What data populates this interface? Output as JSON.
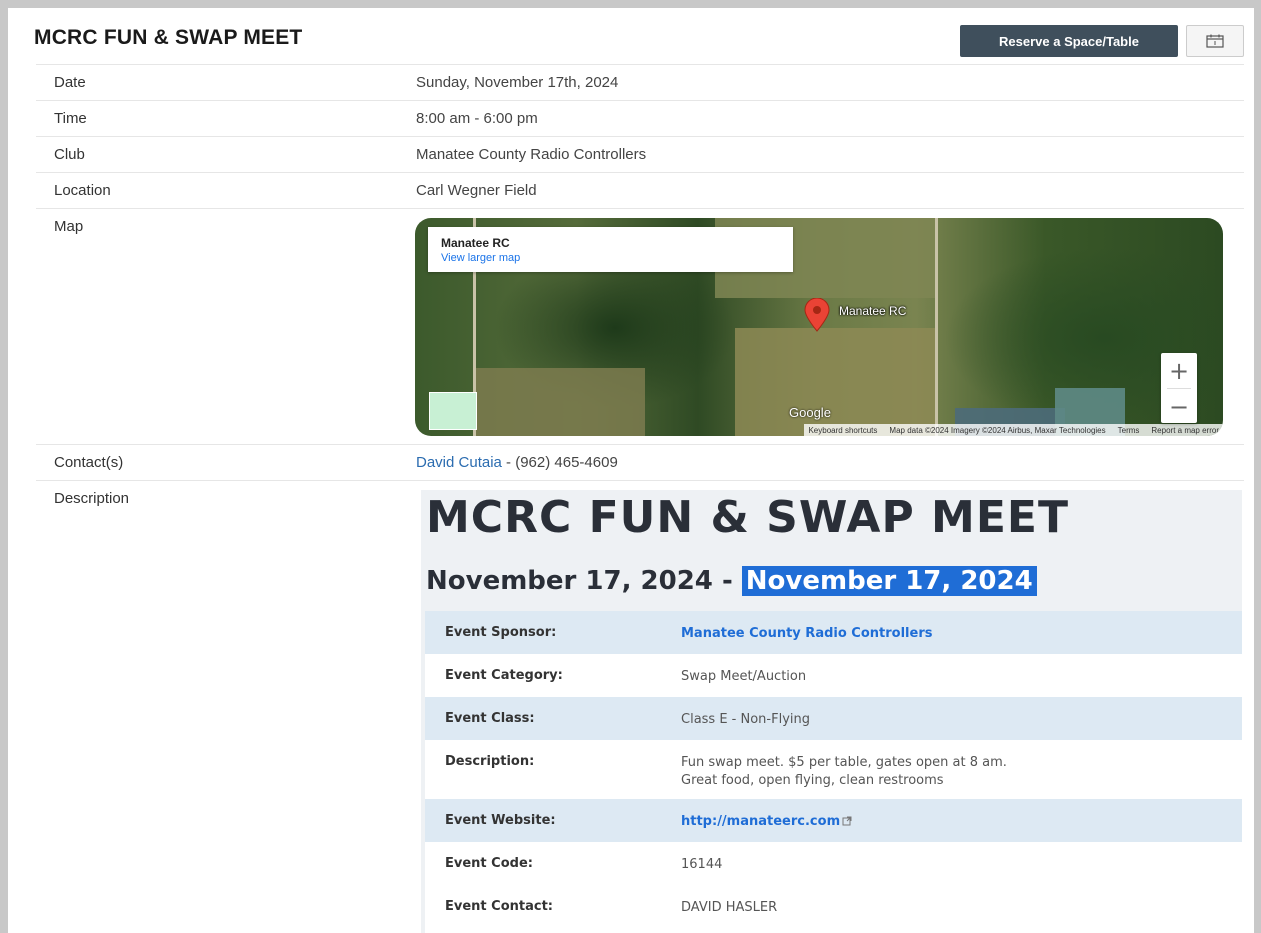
{
  "event": {
    "title": "MCRC FUN & SWAP MEET",
    "reserve_label": "Reserve a Space/Table"
  },
  "details": {
    "date_label": "Date",
    "date_value": "Sunday, November 17th, 2024",
    "time_label": "Time",
    "time_value": "8:00 am - 6:00 pm",
    "club_label": "Club",
    "club_value": "Manatee County Radio Controllers",
    "location_label": "Location",
    "location_value": "Carl Wegner Field",
    "map_label": "Map",
    "contacts_label": "Contact(s)",
    "contact_name": "David Cutaia",
    "contact_phone": " - (962) 465-4609",
    "description_label": "Description"
  },
  "map": {
    "place_name": "Manatee RC",
    "view_larger": "View larger map",
    "pin_label": "Manatee RC",
    "zoom_in": "+",
    "zoom_out": "−",
    "google": "Google",
    "footer": [
      "Keyboard shortcuts",
      "Map data ©2024 Imagery ©2024 Airbus, Maxar Technologies",
      "Terms",
      "Report a map error"
    ]
  },
  "description": {
    "heading": "MCRC FUN & SWAP MEET",
    "date_start": "November 17, 2024 - ",
    "date_end": "November 17, 2024",
    "rows": [
      {
        "key": "Event Sponsor:",
        "value": "Manatee County Radio Controllers"
      },
      {
        "key": "Event Category:",
        "value": "Swap Meet/Auction"
      },
      {
        "key": "Event Class:",
        "value": "Class E - Non-Flying"
      },
      {
        "key": "Description:",
        "value_line1": "Fun swap meet. $5 per table, gates open at 8 am.",
        "value_line2": "Great food, open flying, clean restrooms"
      },
      {
        "key": "Event Website:",
        "value": "http://manateerc.com"
      },
      {
        "key": "Event Code:",
        "value": "16144"
      },
      {
        "key": "Event Contact:",
        "value": "DAVID HASLER"
      }
    ]
  },
  "colors": {
    "reserve_button": "#3f4f5c",
    "link": "#2b6cb0",
    "highlight": "#1f6dd6"
  }
}
